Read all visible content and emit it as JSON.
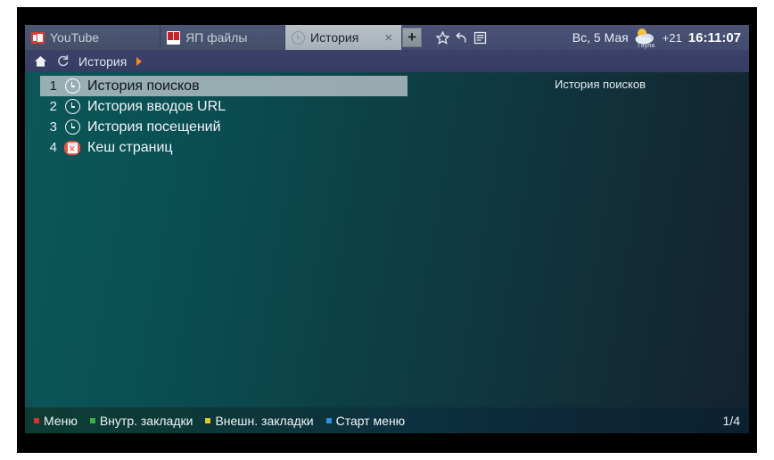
{
  "browser": {
    "tabs": [
      {
        "label": "YouTube",
        "icon": "youtube-favicon",
        "active": false,
        "closable": false
      },
      {
        "label": "ЯП файлы",
        "icon": "yap-favicon",
        "active": false,
        "closable": false
      },
      {
        "label": "История",
        "icon": "clock-favicon",
        "active": true,
        "closable": true,
        "close_label": "×"
      }
    ],
    "new_tab_label": "+",
    "toolbar_icons": [
      {
        "name": "star-icon",
        "title": "Закладки"
      },
      {
        "name": "undo-arrow-icon",
        "title": "Назад"
      },
      {
        "name": "list-menu-icon",
        "title": "Меню"
      }
    ]
  },
  "status": {
    "date": "Вс, 5 Мая",
    "weather_icon": "sun-behind-cloud-icon",
    "city": "Гаула",
    "temperature": "+21",
    "time": "16:11:07"
  },
  "breadcrumb": {
    "home_icon": "home-icon",
    "reload_icon": "reload-icon",
    "path": "История",
    "arrow_icon": "caret-right-icon"
  },
  "main": {
    "preview_title": "История поисков",
    "items": [
      {
        "number": "1",
        "label": "История поисков",
        "icon": "clock-icon",
        "selected": true
      },
      {
        "number": "2",
        "label": "История вводов URL",
        "icon": "clock-icon",
        "selected": false
      },
      {
        "number": "3",
        "label": "История посещений",
        "icon": "clock-icon",
        "selected": false
      },
      {
        "number": "4",
        "label": "Кеш страниц",
        "icon": "cache-delete-icon",
        "selected": false
      }
    ]
  },
  "footer": {
    "hints": [
      {
        "label": "Меню",
        "color": "#e02d2d"
      },
      {
        "label": "Внутр. закладки",
        "color": "#35b34a"
      },
      {
        "label": "Внешн. закладки",
        "color": "#e0c92b"
      },
      {
        "label": "Старт меню",
        "color": "#2f8fe0"
      }
    ],
    "pager": "1/4"
  },
  "colors": {
    "tabbar": "#454d70",
    "breadcrumb": "#383e64",
    "screen_left": "#0b585a",
    "screen_right": "#14222e",
    "footer_left": "#0d3c34",
    "selection": "#bac4c9",
    "accent_orange": "#f08a1a"
  }
}
